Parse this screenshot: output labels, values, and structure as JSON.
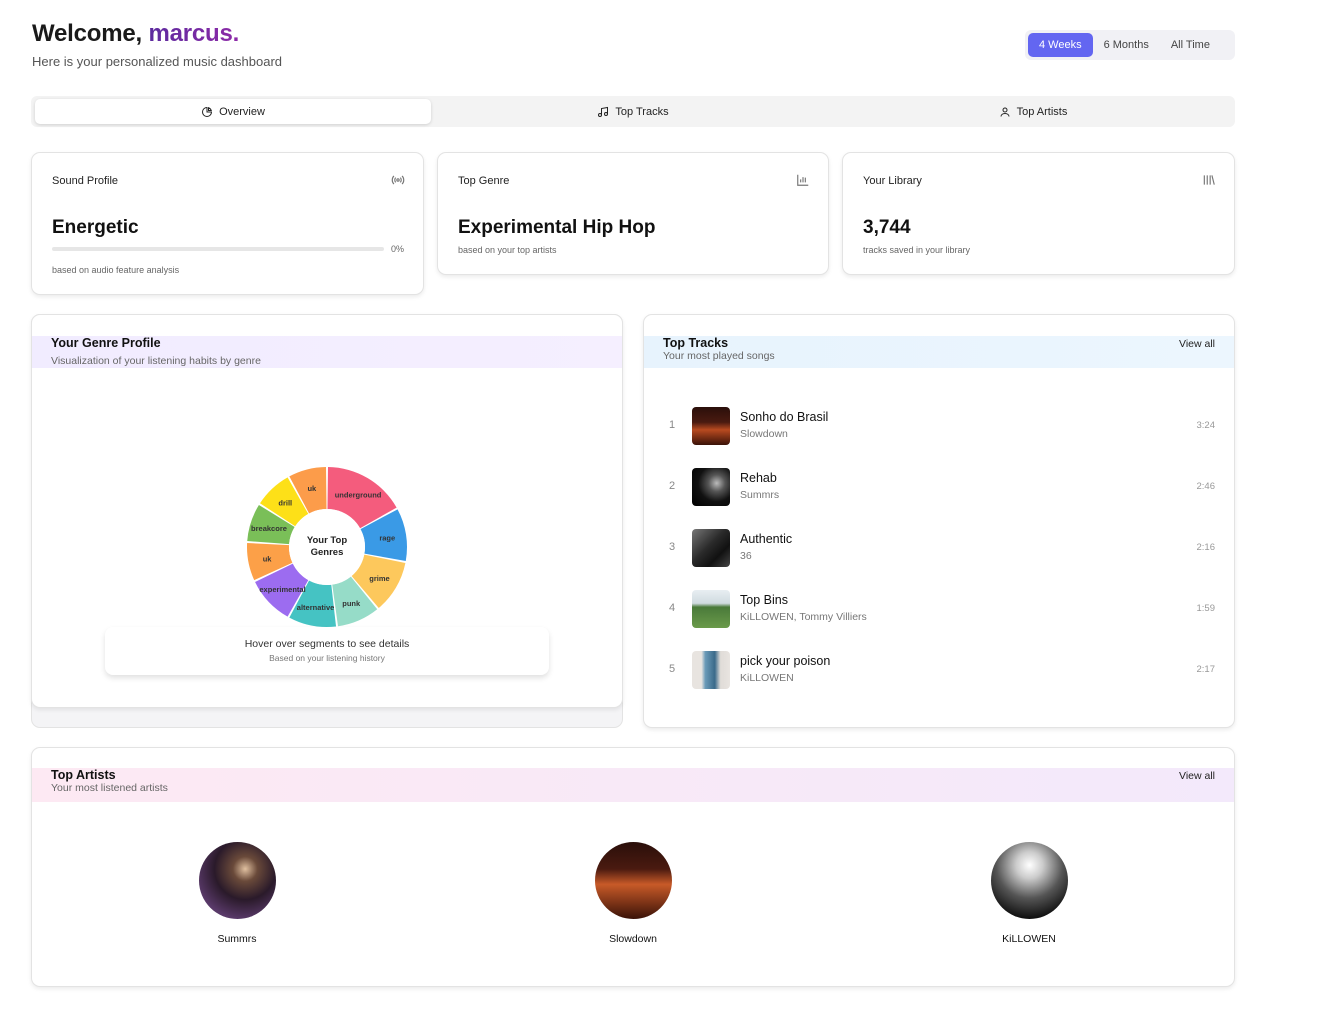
{
  "header": {
    "welcome_prefix": "Welcome,",
    "username": "marcus.",
    "subtitle": "Here is your personalized music dashboard"
  },
  "time_range": {
    "options": [
      "4 Weeks",
      "6 Months",
      "All Time"
    ],
    "selected": "4 Weeks",
    "accent": "#6366f1"
  },
  "tabs": [
    {
      "label": "Overview",
      "icon": "pie-chart-icon",
      "active": true
    },
    {
      "label": "Top Tracks",
      "icon": "music-note-icon",
      "active": false
    },
    {
      "label": "Top Artists",
      "icon": "user-icon",
      "active": false
    }
  ],
  "stats": {
    "sound_profile": {
      "label": "Sound Profile",
      "icon": "radio-signal-icon",
      "value": "Energetic",
      "progress_text": "0%",
      "progress_fraction": 0,
      "caption": "based on audio feature analysis"
    },
    "top_genre": {
      "label": "Top Genre",
      "icon": "bar-chart-icon",
      "value": "Experimental Hip Hop",
      "caption": "based on your top artists"
    },
    "library": {
      "label": "Your Library",
      "icon": "library-icon",
      "value": "3,744",
      "caption": "tracks saved in your library"
    }
  },
  "genre_profile": {
    "title": "Your Genre Profile",
    "subtitle": "Visualization of your listening habits by genre",
    "center_label_line1": "Your Top",
    "center_label_line2": "Genres",
    "hover_hint": "Hover over segments to see details",
    "hover_sub": "Based on your listening history"
  },
  "chart_data": {
    "type": "pie",
    "categories": [
      "underground",
      "rage",
      "grime",
      "punk",
      "alternative",
      "experimental",
      "uk",
      "breakcore",
      "drill",
      "uk"
    ],
    "values": [
      17,
      11,
      11,
      9,
      10,
      10,
      8,
      8,
      8,
      8
    ],
    "colors": [
      "#f45c7d",
      "#3a9ae6",
      "#fdc85c",
      "#96dcc8",
      "#45c3c3",
      "#9c6cf0",
      "#fca048",
      "#7abf58",
      "#fde018",
      "#fc9c4a"
    ],
    "title": "",
    "donut": true
  },
  "top_tracks": {
    "title": "Top Tracks",
    "subtitle": "Your most played songs",
    "view_all": "View all",
    "items": [
      {
        "rank": "1",
        "title": "Sonho do Brasil",
        "artist": "Slowdown",
        "duration": "3:24"
      },
      {
        "rank": "2",
        "title": "Rehab",
        "artist": "Summrs",
        "duration": "2:46"
      },
      {
        "rank": "3",
        "title": "Authentic",
        "artist": "36",
        "duration": "2:16"
      },
      {
        "rank": "4",
        "title": "Top Bins",
        "artist": "KiLLOWEN, Tommy Villiers",
        "duration": "1:59"
      },
      {
        "rank": "5",
        "title": "pick your poison",
        "artist": "KiLLOWEN",
        "duration": "2:17"
      }
    ]
  },
  "top_artists": {
    "title": "Top Artists",
    "subtitle": "Your most listened artists",
    "view_all": "View all",
    "items": [
      {
        "name": "Summrs"
      },
      {
        "name": "Slowdown"
      },
      {
        "name": "KiLLOWEN"
      }
    ]
  }
}
